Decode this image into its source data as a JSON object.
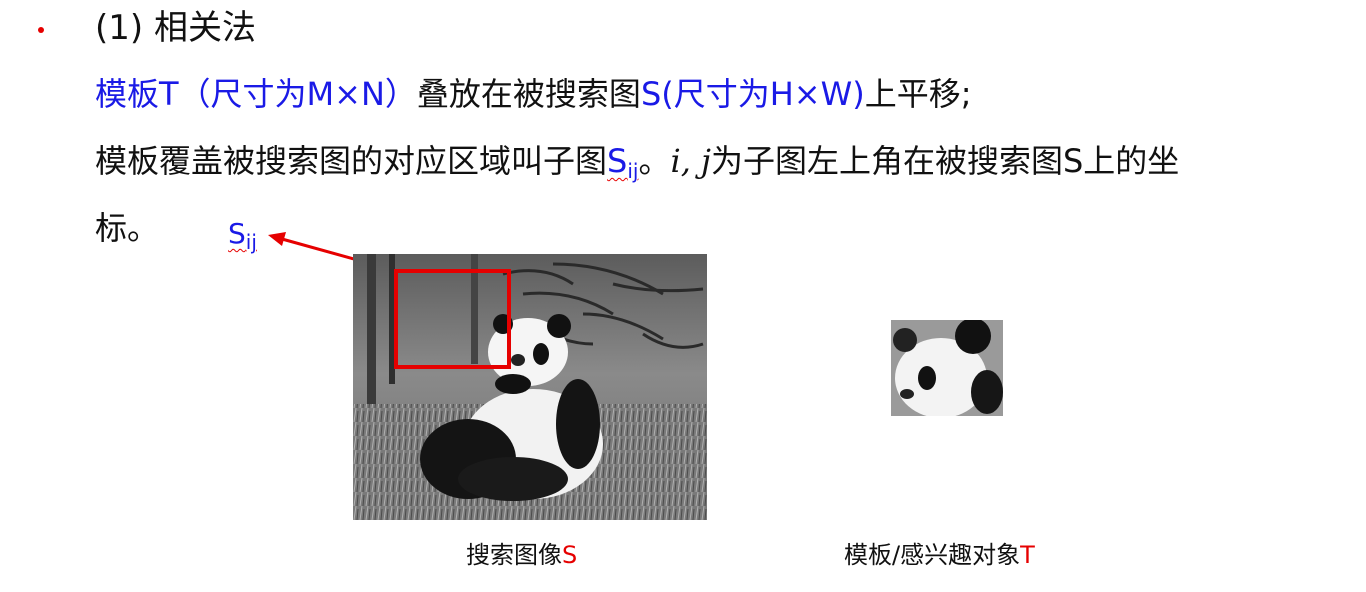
{
  "heading": {
    "bullet_color": "#e60000",
    "text": "(1) 相关法"
  },
  "paragraph1": {
    "blue_part": "模板T（尺寸为M×N）",
    "black_part": "叠放在被搜索图",
    "blue_part2": "S(尺寸为H×W)",
    "black_part2": "上平移;"
  },
  "paragraph2": {
    "text_a": "模板覆盖被搜索图的对应区域叫子图",
    "sub_main": "S",
    "sub_index": "ij",
    "text_b": "。",
    "math": "i, j",
    "text_c": "为子图左上角在被搜索图S上的坐",
    "text_d": "标。"
  },
  "arrow_label": {
    "main": "S",
    "index": "ij"
  },
  "figures": {
    "search_image": {
      "icon": "panda-scene-photo",
      "caption_text": "搜索图像",
      "caption_letter": "S",
      "highlight_color": "#e60000"
    },
    "template_image": {
      "icon": "panda-face-photo",
      "caption_text": "模板/感兴趣对象",
      "caption_letter": "T"
    }
  },
  "colors": {
    "blue": "#1a1ae6",
    "red": "#e60000",
    "text": "#111111"
  }
}
